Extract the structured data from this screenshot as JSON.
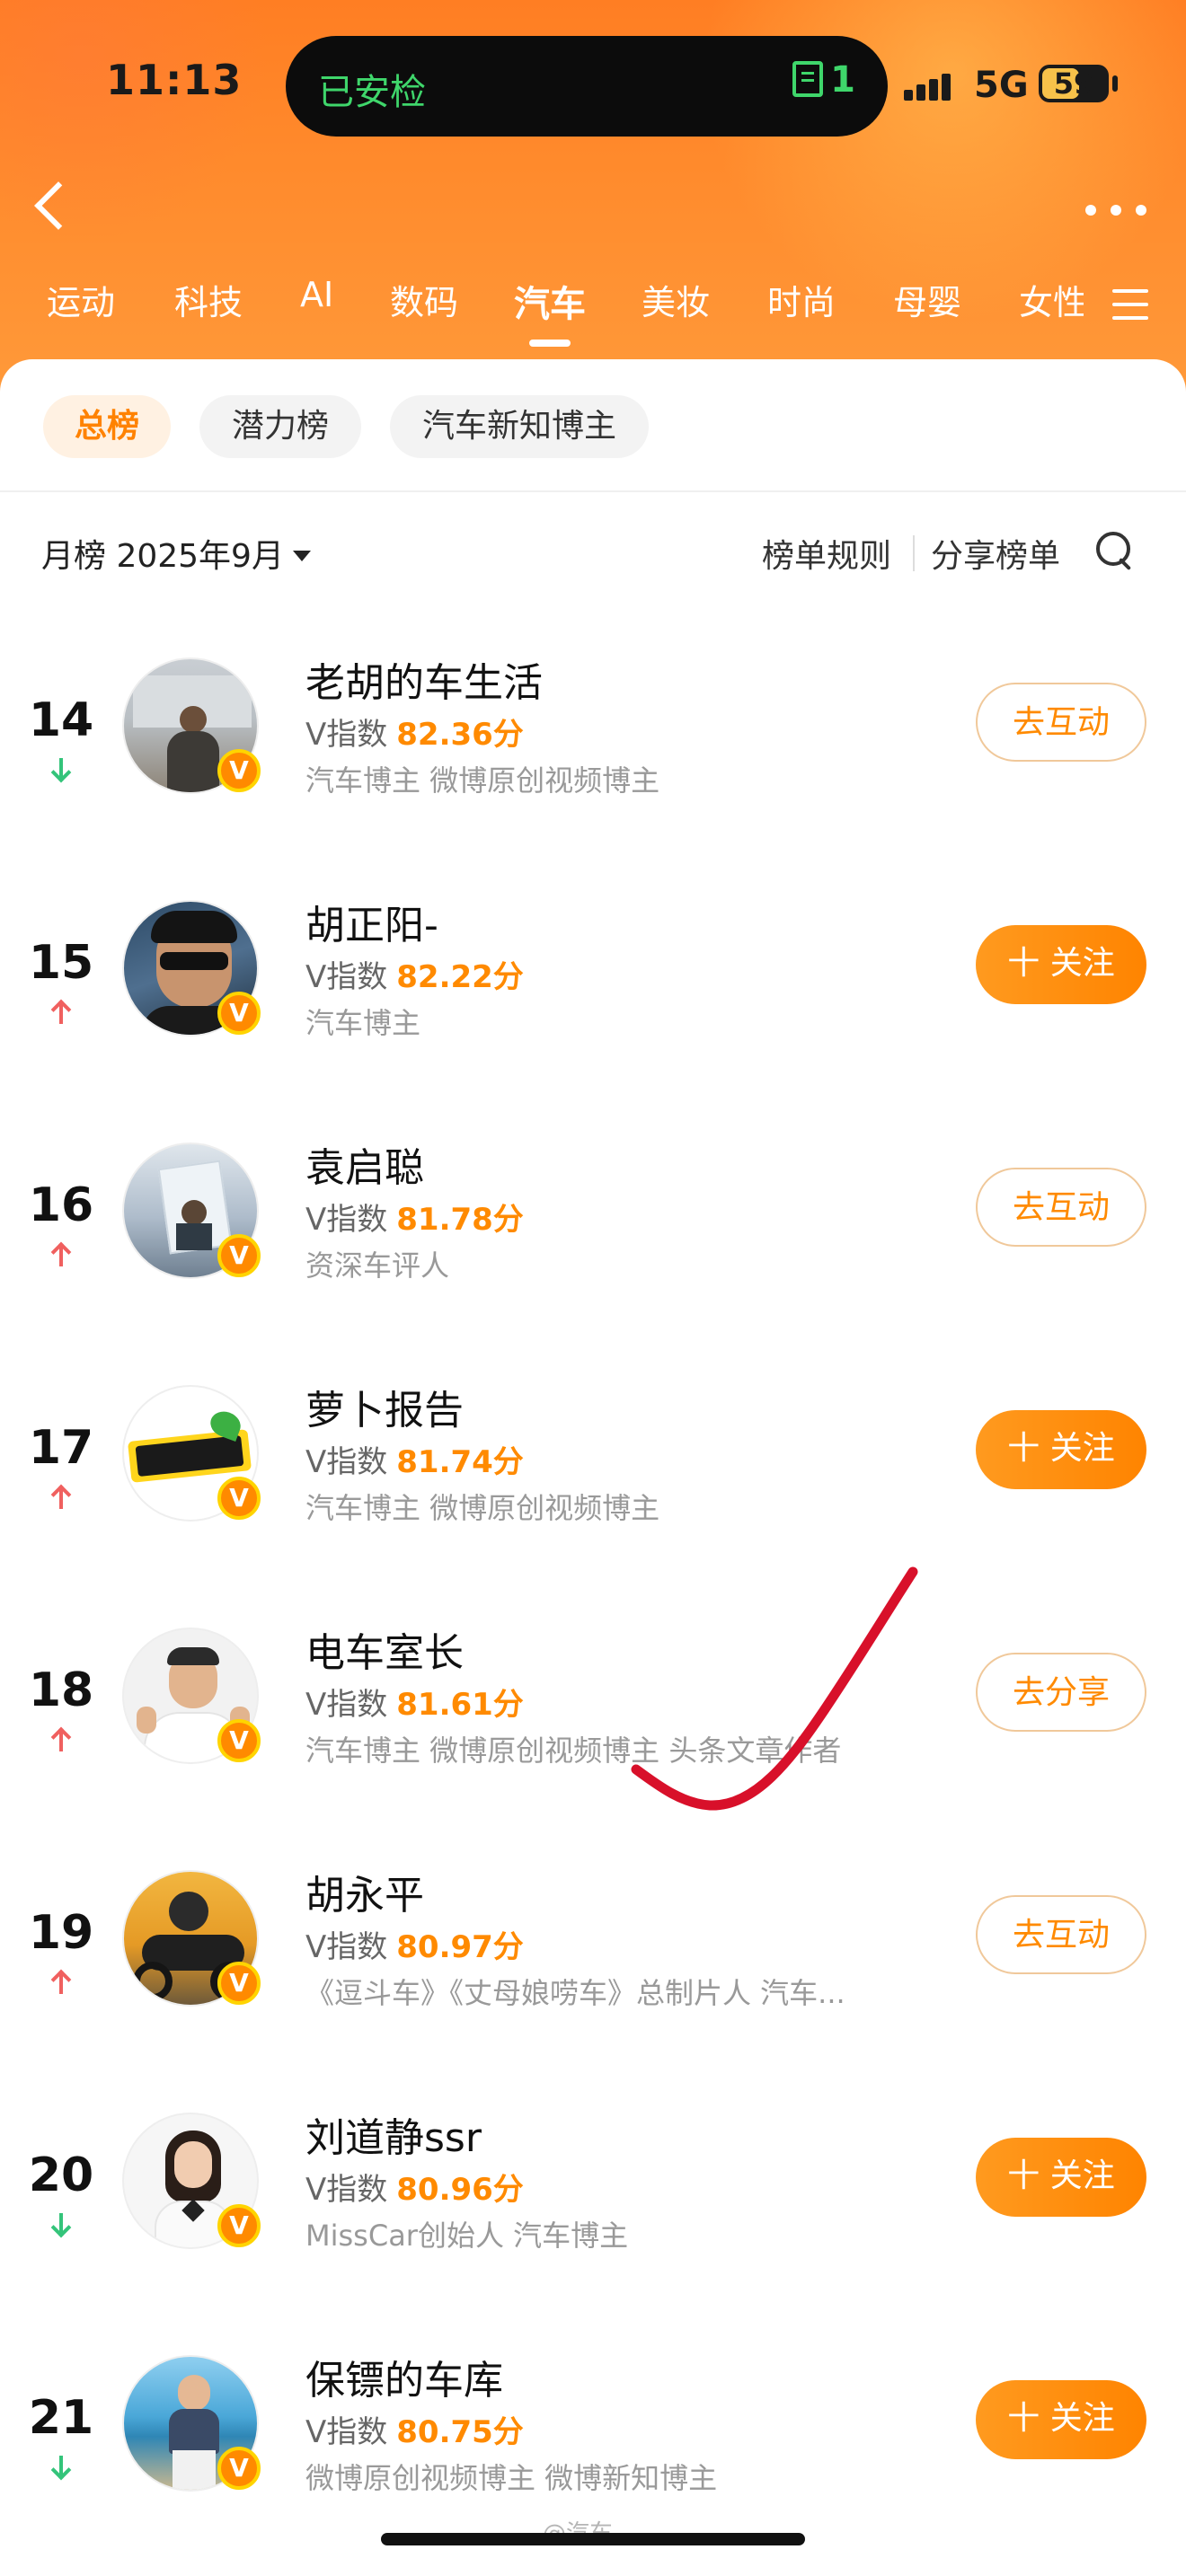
{
  "status_bar": {
    "time": "11:13",
    "island_label": "已安检",
    "island_count": "1",
    "network": "5G",
    "battery": "59",
    "battery_level": 0.59
  },
  "nav": {
    "back_icon": "chevron-left-icon",
    "more_icon": "ellipsis-icon",
    "categories": [
      "运动",
      "科技",
      "AI",
      "数码",
      "汽车",
      "美妆",
      "时尚",
      "母婴",
      "女性"
    ],
    "active_category": "汽车",
    "menu_icon": "menu-icon"
  },
  "chips": [
    {
      "label": "总榜",
      "active": true
    },
    {
      "label": "潜力榜",
      "active": false
    },
    {
      "label": "汽车新知博主",
      "active": false
    }
  ],
  "subbar": {
    "month": "月榜 2025年9月",
    "rules": "榜单规则",
    "share": "分享榜单",
    "search_icon": "search-icon"
  },
  "list": [
    {
      "rank": "14",
      "trend": "down",
      "name": "老胡的车生活",
      "v_label": "V指数",
      "score": "82.36分",
      "tags": "汽车博主 微博原创视频博主",
      "button": "去互动",
      "button_style": "outline"
    },
    {
      "rank": "15",
      "trend": "up",
      "name": "胡正阳-",
      "v_label": "V指数",
      "score": "82.22分",
      "tags": "汽车博主",
      "button": "十 关注",
      "button_style": "solid"
    },
    {
      "rank": "16",
      "trend": "up",
      "name": "袁启聪",
      "v_label": "V指数",
      "score": "81.78分",
      "tags": "资深车评人",
      "button": "去互动",
      "button_style": "outline"
    },
    {
      "rank": "17",
      "trend": "up",
      "name": "萝卜报告",
      "v_label": "V指数",
      "score": "81.74分",
      "tags": "汽车博主 微博原创视频博主",
      "button": "十 关注",
      "button_style": "solid"
    },
    {
      "rank": "18",
      "trend": "up",
      "name": "电车室长",
      "v_label": "V指数",
      "score": "81.61分",
      "tags": "汽车博主 微博原创视频博主 头条文章作者",
      "button": "去分享",
      "button_style": "outline"
    },
    {
      "rank": "19",
      "trend": "up",
      "name": "胡永平",
      "v_label": "V指数",
      "score": "80.97分",
      "tags": "《逗斗车》《丈母娘唠车》总制片人 汽车...",
      "button": "去互动",
      "button_style": "outline"
    },
    {
      "rank": "20",
      "trend": "down",
      "name": "刘道静ssr",
      "v_label": "V指数",
      "score": "80.96分",
      "tags": "MissCar创始人 汽车博主",
      "button": "十 关注",
      "button_style": "solid"
    },
    {
      "rank": "21",
      "trend": "down",
      "name": "保镖的车库",
      "v_label": "V指数",
      "score": "80.75分",
      "tags": "微博原创视频博主 微博新知博主",
      "button": "十 关注",
      "button_style": "solid"
    }
  ],
  "verified_badge": "V",
  "colors": {
    "accent": "#ff8a00",
    "header": "#ff8a2c",
    "up": "#f0605f",
    "down": "#34c47a",
    "annotation": "#d8102a"
  }
}
